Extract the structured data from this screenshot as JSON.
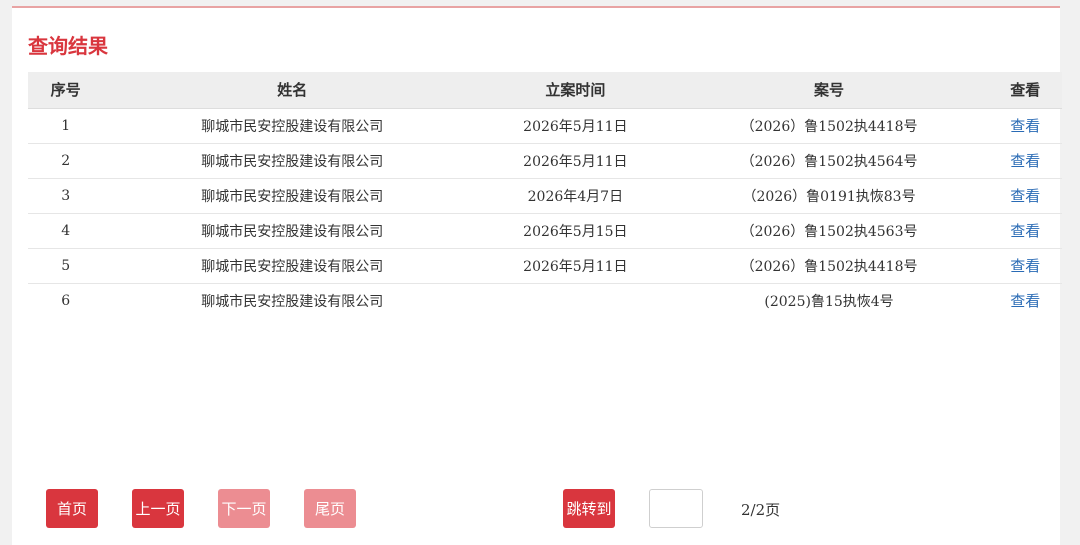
{
  "title": "查询结果",
  "table": {
    "headers": [
      "序号",
      "姓名",
      "立案时间",
      "案号",
      "查看"
    ],
    "rows": [
      {
        "no": "1",
        "name": "聊城市民安控股建设有限公司",
        "date": "2026年5月11日",
        "case": "（2026）鲁1502执4418号",
        "action": "查看"
      },
      {
        "no": "2",
        "name": "聊城市民安控股建设有限公司",
        "date": "2026年5月11日",
        "case": "（2026）鲁1502执4564号",
        "action": "查看"
      },
      {
        "no": "3",
        "name": "聊城市民安控股建设有限公司",
        "date": "2026年4月7日",
        "case": "（2026）鲁0191执恢83号",
        "action": "查看"
      },
      {
        "no": "4",
        "name": "聊城市民安控股建设有限公司",
        "date": "2026年5月15日",
        "case": "（2026）鲁1502执4563号",
        "action": "查看"
      },
      {
        "no": "5",
        "name": "聊城市民安控股建设有限公司",
        "date": "2026年5月11日",
        "case": "（2026）鲁1502执4418号",
        "action": "查看"
      },
      {
        "no": "6",
        "name": "聊城市民安控股建设有限公司",
        "date": "",
        "case": "(2025)鲁15执恢4号",
        "action": "查看"
      }
    ]
  },
  "pagination": {
    "first": "首页",
    "prev": "上一页",
    "next": "下一页",
    "last": "尾页",
    "jump": "跳转到",
    "page_input_value": "",
    "page_info": "2/2页"
  },
  "colors": {
    "accent": "#d9363e",
    "disabled_button": "#ec8d92",
    "link": "#2a6bb5"
  }
}
